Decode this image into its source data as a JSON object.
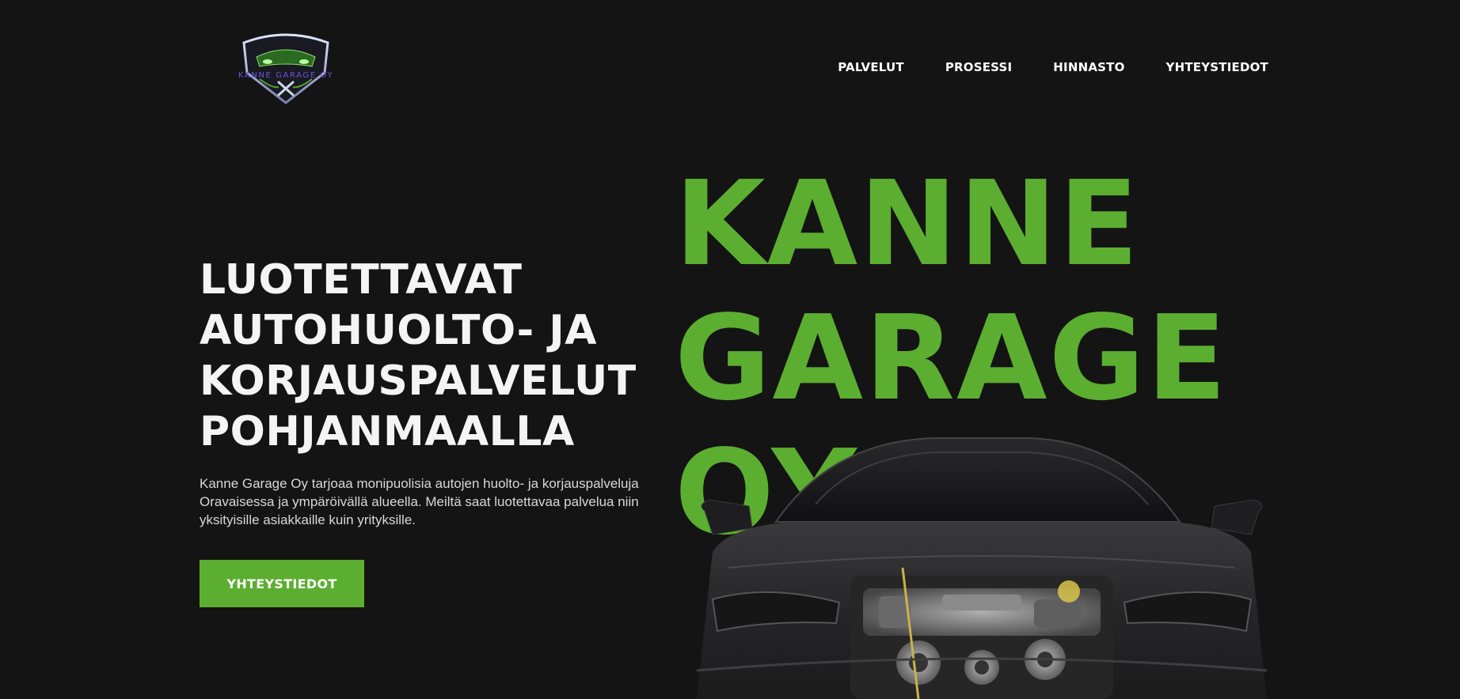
{
  "header": {
    "logo_text": "KANNE GARAGE OY",
    "nav": [
      {
        "label": "PALVELUT"
      },
      {
        "label": "PROSESSI"
      },
      {
        "label": "HINNASTO"
      },
      {
        "label": "YHTEYSTIEDOT"
      }
    ]
  },
  "hero": {
    "headline_lines": [
      "LUOTETTAVAT",
      "AUTOHUOLTO- JA",
      "KORJAUSPALVELUT",
      "POHJANMAALLA"
    ],
    "lead": "Kanne Garage Oy tarjoaa monipuolisia autojen huolto- ja korjauspalveluja Oravaisessa ja ympäröivällä alueella. Meiltä saat luotettavaa palvelua niin yksityisille asiakkaille kuin yrityksille.",
    "cta_label": "YHTEYSTIEDOT"
  },
  "wordmark": {
    "lines": [
      "KANNE",
      "GARAGE",
      "OY"
    ]
  },
  "colors": {
    "background": "#141414",
    "accent_green": "#5cae31",
    "logo_purple": "#6a55e0"
  }
}
